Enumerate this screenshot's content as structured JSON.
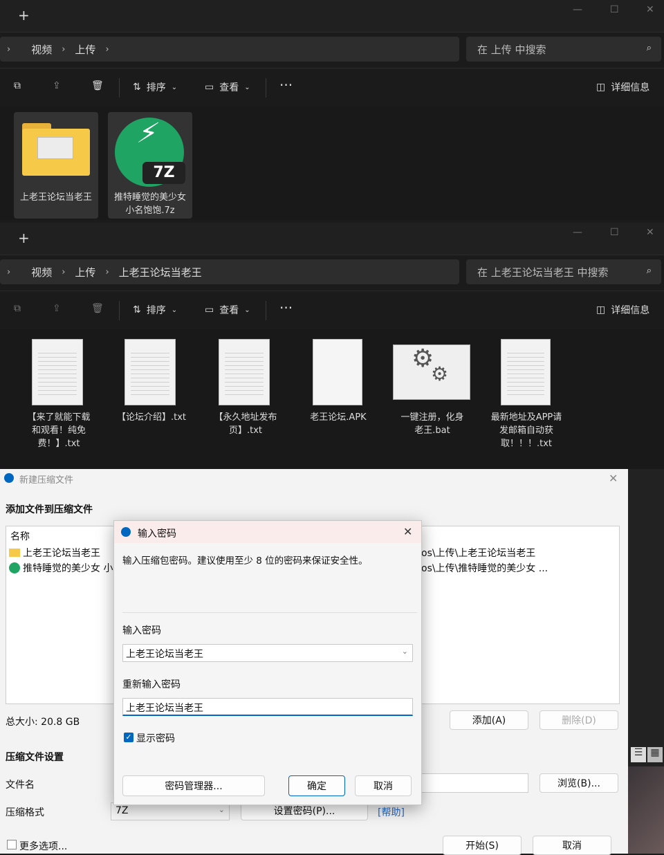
{
  "window1": {
    "breadcrumb": [
      "视频",
      "上传"
    ],
    "search_placeholder": "在 上传 中搜索",
    "toolbar": {
      "sort": "排序",
      "view": "查看",
      "details": "详细信息"
    },
    "items": [
      {
        "name": "上老王论坛当老王",
        "type": "folder"
      },
      {
        "name": "推特睡觉的美少女 小名饱饱.7z",
        "type": "7z",
        "badge": "7Z"
      }
    ]
  },
  "window2": {
    "breadcrumb": [
      "视频",
      "上传",
      "上老王论坛当老王"
    ],
    "search_placeholder": "在 上老王论坛当老王 中搜索",
    "toolbar": {
      "sort": "排序",
      "view": "查看",
      "details": "详细信息"
    },
    "items": [
      {
        "name": "【来了就能下载和观看！纯免费！】.txt",
        "type": "txt"
      },
      {
        "name": "【论坛介绍】.txt",
        "type": "txt"
      },
      {
        "name": "【永久地址发布页】.txt",
        "type": "txt"
      },
      {
        "name": "老王论坛.APK",
        "type": "blank"
      },
      {
        "name": "一键注册，化身老王.bat",
        "type": "bat"
      },
      {
        "name": "最新地址及APP请发邮箱自动获取！！！.txt",
        "type": "txt"
      }
    ]
  },
  "archive_dialog": {
    "title": "新建压缩文件",
    "heading": "添加文件到压缩文件",
    "col_name": "名称",
    "files": [
      {
        "name": "上老王论坛当老王",
        "path": "os\\上传\\上老王论坛当老王"
      },
      {
        "name": "推特睡觉的美少女 小",
        "path": "os\\上传\\推特睡觉的美少女 ..."
      }
    ],
    "total_size": "总大小: 20.8 GB",
    "add": "添加(A)",
    "delete": "删除(D)",
    "settings_heading": "压缩文件设置",
    "filename_label": "文件名",
    "browse": "浏览(B)...",
    "format_label": "压缩格式",
    "format_value": "7Z",
    "set_password": "设置密码(P)...",
    "help": "[帮助]",
    "more_options": "更多选项...",
    "start": "开始(S)",
    "cancel": "取消"
  },
  "password_dialog": {
    "title": "输入密码",
    "message": "输入压缩包密码。建议使用至少 8 位的密码来保证安全性。",
    "password_label": "输入密码",
    "password_value": "上老王论坛当老王",
    "repeat_label": "重新输入密码",
    "repeat_value": "上老王论坛当老王",
    "show_password": "显示密码",
    "show_password_checked": true,
    "manager": "密码管理器...",
    "ok": "确定",
    "cancel": "取消"
  },
  "colors": {
    "accent": "#0067c0",
    "folder": "#f7c948",
    "sevenzip_green": "#1fa463"
  }
}
